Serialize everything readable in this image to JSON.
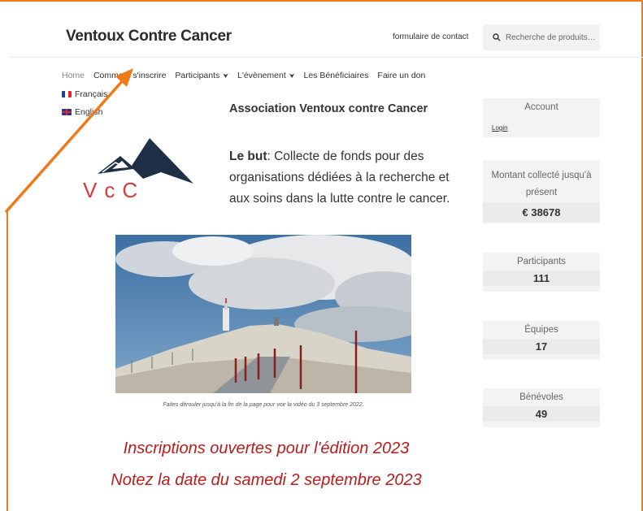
{
  "header": {
    "site_title": "Ventoux Contre Cancer",
    "contact_link": "formulaire de contact",
    "search_placeholder": "Recherche de produits…"
  },
  "nav": {
    "items": [
      {
        "label": "Home"
      },
      {
        "label": "Comment s'inscrire"
      },
      {
        "label": "Participants",
        "has_dropdown": true
      },
      {
        "label": "L'évènement",
        "has_dropdown": true
      },
      {
        "label": "Les Bénéficiaires"
      },
      {
        "label": "Faire un don"
      },
      {
        "label": "Français",
        "flag": "flag-fr-icon"
      },
      {
        "label": "English",
        "flag": "flag-uk-icon"
      }
    ]
  },
  "main": {
    "title": "Association Ventoux contre Cancer",
    "goal_label": "Le but",
    "goal_text": ": Collecte de fonds pour des organisations dédiées à la recherche et aux soins dans la lutte contre le cancer.",
    "logo_text": "VcC",
    "photo_caption": "Faites dérouler jusqu'à la fin de la page pour voir la vidéo du 3 septembre 2022.",
    "promo_line1": "Inscriptions ouvertes pour l'édition 2023",
    "promo_line2": "Notez la date du samedi 2 septembre 2023"
  },
  "sidebar": {
    "account_title": "Account",
    "login_label": "Login",
    "amount_label": "Montant collecté jusqu'à présent",
    "amount_value": "€ 38678",
    "participants_label": "Participants",
    "participants_value": "111",
    "teams_label": "Équipes",
    "teams_value": "17",
    "volunteers_label": "Bénévoles",
    "volunteers_value": "49"
  },
  "colors": {
    "annotation": "#f07a1a",
    "promo_red": "#b91c1c",
    "logo_red": "#d93a3a",
    "logo_navy": "#1f2f45"
  }
}
